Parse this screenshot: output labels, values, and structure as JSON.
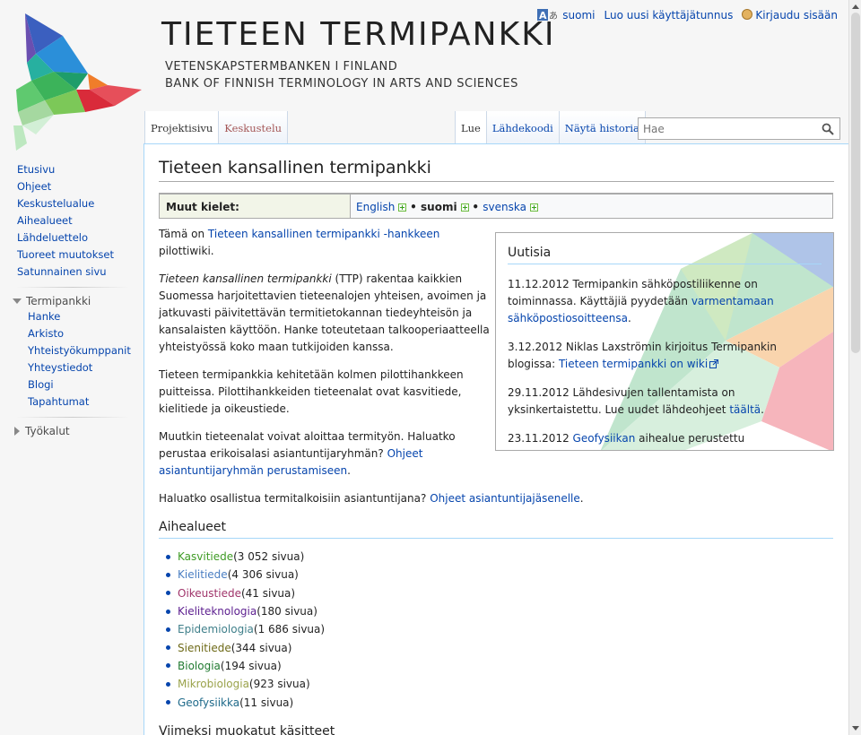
{
  "header": {
    "title": "TIETEEN TERMIPANKKI",
    "subtitle_1": "VETENSKAPSTERMBANKEN I FINLAND",
    "subtitle_2": "BANK OF FINNISH TERMINOLOGY IN ARTS AND SCIENCES"
  },
  "personal": {
    "language": "suomi",
    "create_account": "Luo uusi käyttäjätunnus",
    "login": "Kirjaudu sisään"
  },
  "tabs_left": [
    "Projektisivu",
    "Keskustelu"
  ],
  "tabs_right": [
    "Lue",
    "Lähdekoodi",
    "Näytä historia"
  ],
  "search": {
    "placeholder": "Hae"
  },
  "sidebar": {
    "main": [
      "Etusivu",
      "Ohjeet",
      "Keskustelualue",
      "Aihealueet",
      "Lähdeluettelo",
      "Tuoreet muutokset",
      "Satunnainen sivu"
    ],
    "portal_heading": "Termipankki",
    "portal": [
      "Hanke",
      "Arkisto",
      "Yhteistyökumppanit",
      "Yhteystiedot",
      "Blogi",
      "Tapahtumat"
    ],
    "tools_heading": "Työkalut"
  },
  "content": {
    "page_title": "Tieteen kansallinen termipankki",
    "lang_box": {
      "label": "Muut kielet:",
      "english": "English",
      "suomi": "suomi",
      "svenska": "svenska"
    },
    "p1_pre": "Tämä on ",
    "p1_link": "Tieteen kansallinen termipankki -hankkeen",
    "p1_post": " pilottiwiki.",
    "p2_em": "Tieteen kansallinen termipankki",
    "p2_text": " (TTP) rakentaa kaikkien Suomessa harjoitettavien tieteenalojen yhteisen, avoimen ja jatkuvasti päivitettävän termitietokannan tiedeyhteisön ja kansalaisten käyttöön. Hanke toteutetaan talkooperiaatteella yhteistyössä koko maan tutkijoiden kanssa.",
    "p3": "Tieteen termipankkia kehitetään kolmen pilottihankkeen puitteissa. Pilottihankkeiden tieteenalat ovat kasvitiede, kielitiede ja oikeustiede.",
    "p4_text": "Muutkin tieteenalat voivat aloittaa termityön. Haluatko perustaa erikoisalasi asiantuntijaryhmän? ",
    "p4_link": "Ohjeet asiantuntijaryhmän perustamiseen",
    "p4_post": ".",
    "p5_text": "Haluatko osallistua termitalkoisiin asiantuntijana? ",
    "p5_link": "Ohjeet asiantuntijajäsenelle",
    "p5_post": ".",
    "fields_heading": "Aihealueet",
    "fields": [
      {
        "name": "Kasvitiede",
        "count": " (3 052 sivua)",
        "color": "#3e9b24"
      },
      {
        "name": "Kielitiede",
        "count": " (4 306 sivua)",
        "color": "#4a7ec2"
      },
      {
        "name": "Oikeustiede",
        "count": " (41 sivua)",
        "color": "#a0346a"
      },
      {
        "name": "Kieliteknologia",
        "count": " (180 sivua)",
        "color": "#5c1e8f"
      },
      {
        "name": "Epidemiologia",
        "count": " (1 686 sivua)",
        "color": "#3f7f8a"
      },
      {
        "name": "Sienitiede",
        "count": " (344 sivua)",
        "color": "#6e6a18"
      },
      {
        "name": "Biologia",
        "count": " (194 sivua)",
        "color": "#207a30"
      },
      {
        "name": "Mikrobiologia",
        "count": " (923 sivua)",
        "color": "#9aa24a"
      },
      {
        "name": "Geofysiikka",
        "count": " (11 sivua)",
        "color": "#1f6a8a"
      }
    ],
    "recent_heading": "Viimeksi muokatut käsitteet"
  },
  "news": {
    "title": "Uutisia",
    "items": [
      {
        "date": "11.12.2012",
        "text": " Termipankin sähköpostiliikenne on toiminnassa. Käyttäjiä pyydetään ",
        "link": "varmentamaan sähköpostiosoitteensa",
        "post": "."
      },
      {
        "date": "3.12.2012",
        "text": " Niklas Laxströmin kirjoitus Termipankin blogissa: ",
        "link": "Tieteen termipankki on wiki",
        "post": ""
      },
      {
        "date": "29.11.2012",
        "text": " Lähdesivujen tallentamista on yksinkertaistettu. Lue uudet lähdeohjeet ",
        "link": "täältä",
        "post": "."
      },
      {
        "date": "23.11.2012",
        "text": " ",
        "link": "Geofysiikan",
        "post": " aihealue perustettu"
      }
    ]
  },
  "colors": {
    "link": "#0645ad",
    "new_link": "#a55858",
    "border": "#a7d7f9"
  }
}
